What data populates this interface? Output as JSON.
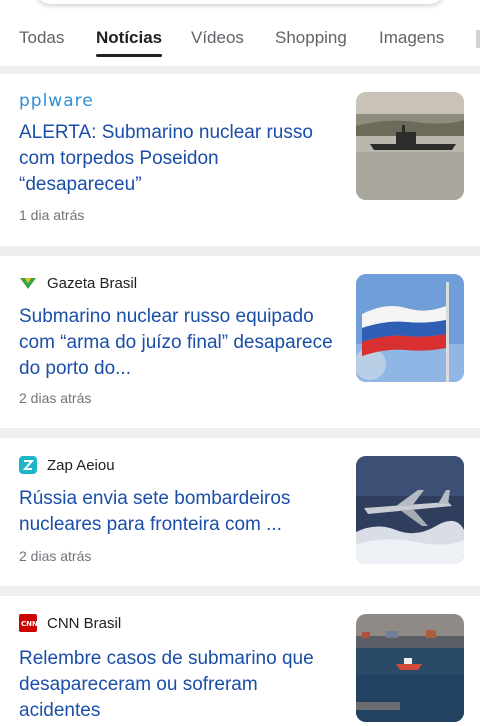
{
  "tabs": [
    {
      "label": "Todas"
    },
    {
      "label": "Notícias",
      "active": true
    },
    {
      "label": "Vídeos"
    },
    {
      "label": "Shopping"
    },
    {
      "label": "Imagens"
    }
  ],
  "articles": [
    {
      "source": "pplware",
      "headline": "ALERTA: Submarino nuclear russo com torpedos Poseidon “desapareceu”",
      "time": "1 dia atrás",
      "thumb_icon": "submarine-photo"
    },
    {
      "source": "Gazeta Brasil",
      "headline": "Submarino nuclear russo equipado com “arma do juízo final” desaparece do porto do...",
      "time": "2 dias atrás",
      "thumb_icon": "russian-flag-photo"
    },
    {
      "source": "Zap Aeiou",
      "headline": "Rússia envia sete bombardeiros nucleares para fronteira com ...",
      "time": "2 dias atrás",
      "thumb_icon": "bomber-plane-photo"
    },
    {
      "source": "CNN Brasil",
      "headline": "Relembre casos de submarino que desapareceram ou sofreram acidentes",
      "time": "",
      "thumb_icon": "harbor-photo"
    }
  ],
  "colors": {
    "headline": "#1a4ea8",
    "pplware_logo": "#2f8fd6",
    "gazeta_logo": "#3aa347",
    "zap_logo": "#1fb5c9",
    "cnn_logo": "#cc0000",
    "background": "#eeeff1"
  }
}
